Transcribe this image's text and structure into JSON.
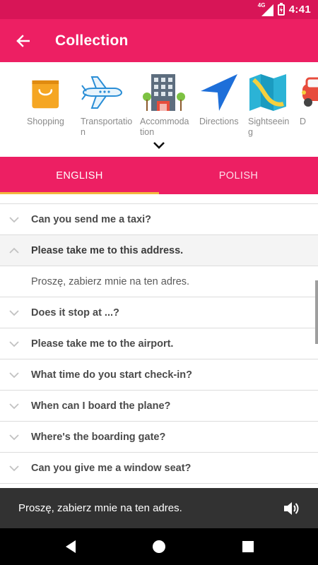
{
  "status_bar": {
    "time": "4:41",
    "network": "4G"
  },
  "app_bar": {
    "title": "Collection",
    "back_icon": "arrow-back-icon"
  },
  "categories": [
    {
      "label": "Shopping",
      "icon": "shopping-bag-icon"
    },
    {
      "label": "Transportation",
      "icon": "airplane-icon"
    },
    {
      "label": "Accommodation",
      "icon": "hotel-icon"
    },
    {
      "label": "Directions",
      "icon": "navigation-arrow-icon"
    },
    {
      "label": "Sightseeing",
      "icon": "map-icon"
    },
    {
      "label": "D",
      "icon": "car-icon"
    }
  ],
  "tabs": [
    {
      "label": "ENGLISH",
      "active": true
    },
    {
      "label": "POLISH",
      "active": false
    }
  ],
  "phrases": [
    {
      "text": "Can you send me a taxi?",
      "expanded": false
    },
    {
      "text": "Please take me to this address.",
      "expanded": true
    },
    {
      "text": "Proszę, zabierz mnie na ten adres.",
      "answer": true
    },
    {
      "text": "Does it stop at ...?",
      "expanded": false
    },
    {
      "text": "Please take me to the airport.",
      "expanded": false
    },
    {
      "text": "What time do you start check-in?",
      "expanded": false
    },
    {
      "text": "When can I board the plane?",
      "expanded": false
    },
    {
      "text": "Where's the boarding gate?",
      "expanded": false
    },
    {
      "text": "Can you give me a window seat?",
      "expanded": false
    }
  ],
  "snackbar": {
    "text": "Proszę, zabierz mnie na ten adres.",
    "icon": "speaker-icon"
  },
  "colors": {
    "primary": "#ed1f63",
    "status": "#d81557",
    "indicator": "#f3b73e"
  }
}
